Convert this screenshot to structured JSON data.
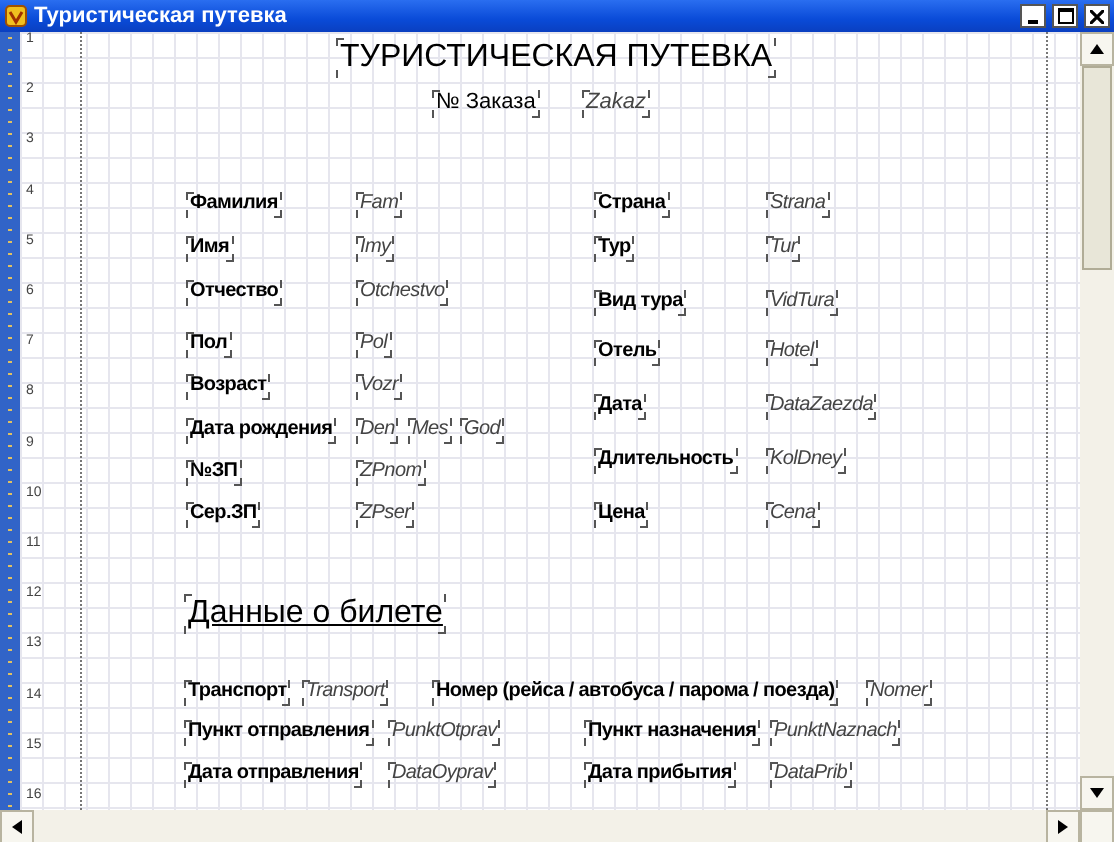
{
  "window": {
    "title": "Туристическая путевка"
  },
  "ruler": [
    "1",
    "2",
    "3",
    "4",
    "5",
    "6",
    "7",
    "8",
    "9",
    "10",
    "11",
    "12",
    "13",
    "14",
    "15",
    "16"
  ],
  "report": {
    "title": "ТУРИСТИЧЕСКАЯ ПУТЕВКА",
    "order": {
      "label": "№ Заказа",
      "field": "Zakaz"
    },
    "client_fields": [
      {
        "label": "Фамилия",
        "field": "Fam"
      },
      {
        "label": "Имя",
        "field": "Imy"
      },
      {
        "label": "Отчество",
        "field": "Otchestvo"
      },
      {
        "label": "Пол",
        "field": "Pol"
      },
      {
        "label": "Возраст",
        "field": "Vozr"
      },
      {
        "label": "Дата рождения",
        "fields": [
          "Den",
          "Mes",
          "God"
        ]
      },
      {
        "label": "№ЗП",
        "field": "ZPnom"
      },
      {
        "label": "Сер.ЗП",
        "field": "ZPser"
      }
    ],
    "tour_fields": [
      {
        "label": "Страна",
        "field": "Strana"
      },
      {
        "label": "Тур",
        "field": "Tur"
      },
      {
        "label": "Вид тура",
        "field": "VidTura"
      },
      {
        "label": "Отель",
        "field": "Hotel"
      },
      {
        "label": "Дата",
        "field": "DataZaezda"
      },
      {
        "label": "Длительность",
        "field": "KolDney"
      },
      {
        "label": "Цена",
        "field": "Cena"
      }
    ],
    "section_title": "Данные о билете",
    "ticket_fields": [
      {
        "label": "Транспорт",
        "field": "Transport"
      },
      {
        "label": "Номер (рейса / автобуса / парома / поезда)",
        "field": "Nomer"
      },
      {
        "label": "Пункт отправления",
        "field": "PunktOtprav"
      },
      {
        "label": "Пункт назначения",
        "field": "PunktNaznach"
      },
      {
        "label": "Дата отправления",
        "field": "DataOyprav"
      },
      {
        "label": "Дата прибытия",
        "field": "DataPrib"
      }
    ]
  }
}
